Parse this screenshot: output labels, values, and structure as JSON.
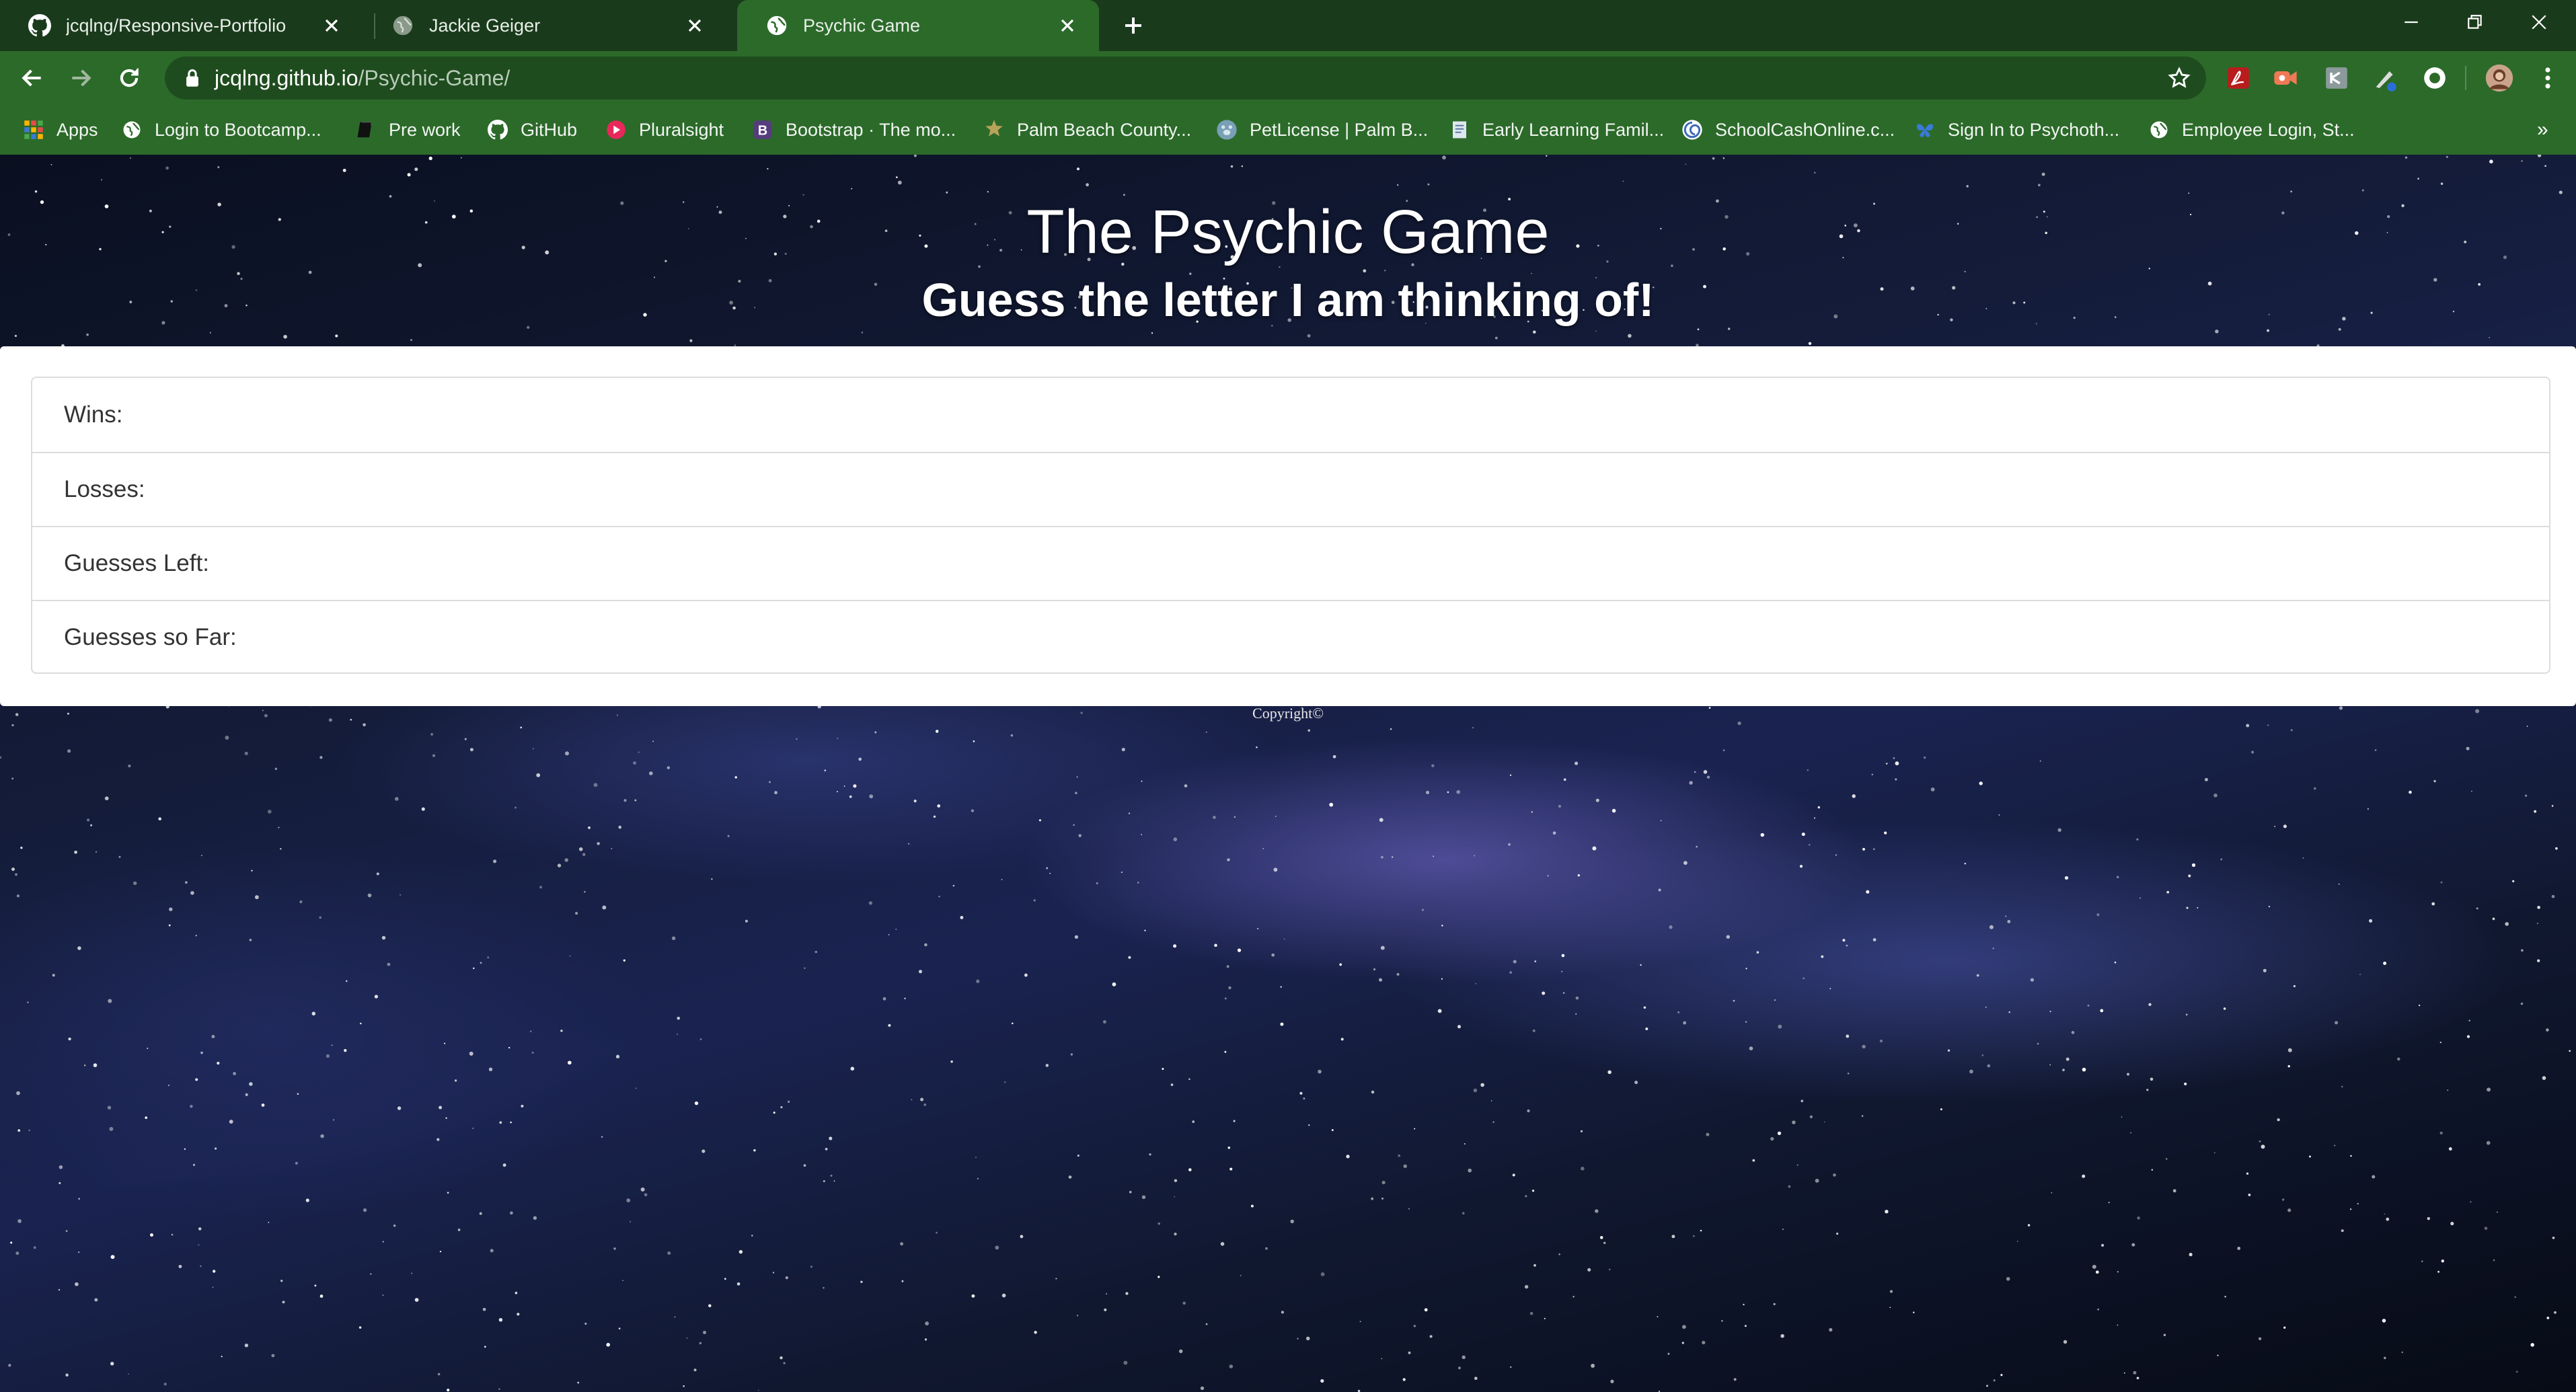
{
  "browser": {
    "tabs": [
      {
        "label": "jcqlng/Responsive-Portfolio",
        "icon": "github-icon",
        "active": false
      },
      {
        "label": "Jackie Geiger",
        "icon": "globe-icon",
        "active": false
      },
      {
        "label": "Psychic Game",
        "icon": "globe-icon",
        "active": true
      }
    ],
    "url_host": "jcqlng.github.io",
    "url_path": "/Psychic-Game/",
    "bookmarks": [
      {
        "label": "Apps",
        "icon": "apps-grid-icon"
      },
      {
        "label": "Login to Bootcamp...",
        "icon": "globe-icon"
      },
      {
        "label": "Pre work",
        "icon": "book-icon"
      },
      {
        "label": "GitHub",
        "icon": "github-icon"
      },
      {
        "label": "Pluralsight",
        "icon": "pluralsight-icon"
      },
      {
        "label": "Bootstrap · The mo...",
        "icon": "bootstrap-icon"
      },
      {
        "label": "Palm Beach County...",
        "icon": "sheriff-star-icon"
      },
      {
        "label": "PetLicense | Palm B...",
        "icon": "paw-icon"
      },
      {
        "label": "Early Learning Famil...",
        "icon": "document-icon"
      },
      {
        "label": "SchoolCashOnline.c...",
        "icon": "swirl-icon"
      },
      {
        "label": "Sign In to Psychoth...",
        "icon": "butterfly-icon"
      },
      {
        "label": "Employee Login, St...",
        "icon": "globe-icon"
      }
    ],
    "bookmarks_overflow": "»"
  },
  "page": {
    "title": "The Psychic Game",
    "subtitle": "Guess the letter I am thinking of!",
    "stats": [
      {
        "label": "Wins:"
      },
      {
        "label": "Losses:"
      },
      {
        "label": "Guesses Left:"
      },
      {
        "label": "Guesses so Far:"
      }
    ],
    "footer": "Copyright©"
  },
  "colors": {
    "tab_bar": "#1a3a1c",
    "toolbar": "#2c6a2a",
    "omnibox": "#1f4c1f",
    "card_bg": "#ffffff",
    "list_border": "#dcdcdc"
  }
}
